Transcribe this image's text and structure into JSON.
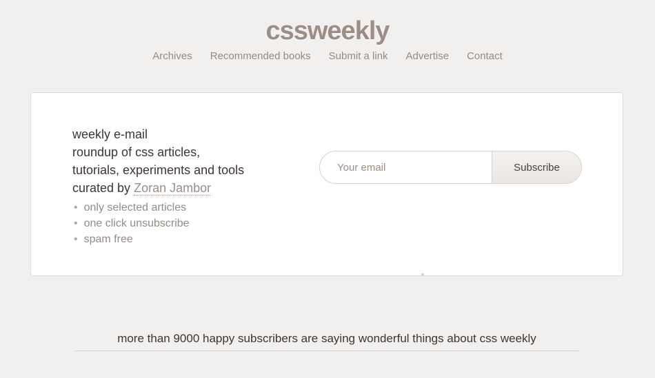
{
  "header": {
    "logo": "cssweekly",
    "nav": [
      "Archives",
      "Recommended books",
      "Submit a link",
      "Advertise",
      "Contact"
    ]
  },
  "signup": {
    "line1": "weekly e-mail",
    "line2": "roundup of css articles,",
    "line3": "tutorials, experiments and tools",
    "line4_prefix": "curated by",
    "author": "Zoran Jambor",
    "features": [
      "only selected articles",
      "one click unsubscribe",
      "spam free"
    ],
    "email_placeholder": "Your email",
    "subscribe_label": "Subscribe"
  },
  "testimonials": {
    "heading": "more than 9000 happy subscribers are saying wonderful things about css weekly"
  },
  "colors": {
    "background": "#f1f0ee",
    "accent": "#9c8e86",
    "text": "#3f3531"
  }
}
